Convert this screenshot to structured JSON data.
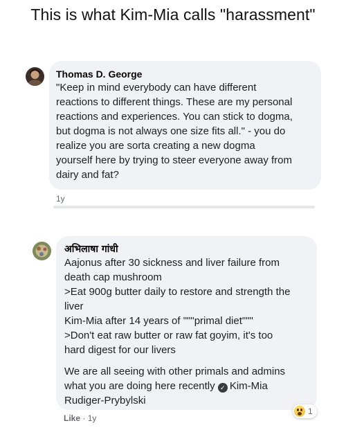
{
  "headline": "This is what Kim-Mia calls \"harassment\"",
  "comments": [
    {
      "author": "Thomas D. George",
      "lines": [
        "\"Keep in mind everybody can have different",
        "reactions to different things. These are my personal",
        "reactions and experiences. You can stick to dogma,",
        "but dogma is not always one size fits all.\" - you do",
        "realize you are sorta creating a new dogma",
        "yourself here by trying to steer everyone away from",
        "dairy and fat?"
      ],
      "time": "1y"
    },
    {
      "author": "अभिलाषा गांधी",
      "lines": [
        "Aajonus after 30 sickness and liver failure from",
        "death cap mushroom",
        ">Eat 900g butter daily to restore and strength the",
        "liver",
        "Kim-Mia after 14 years of \"\"\"primal diet\"\"\"",
        ">Don't eat raw butter or raw fat goyim, it's too",
        "hard digest for our livers"
      ],
      "para2_line1": "We are all seeing with other primals and admins",
      "para2_line2_prefix": "what you are doing here recently",
      "mention": "Kim-Mia",
      "mention_cont": "Rudiger-Prybylski",
      "like_label": "Like",
      "separator": "·",
      "time": "1y",
      "reaction_icon": "wow-emoji-icon",
      "reaction_count": "1"
    }
  ]
}
